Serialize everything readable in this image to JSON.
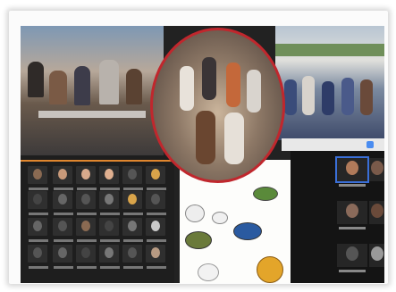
{
  "photo_collage": {
    "description_colors": {
      "accent_red": "#c0272d",
      "accent_orange": "#e0862e",
      "accent_blue": "#3a6fd8"
    }
  }
}
